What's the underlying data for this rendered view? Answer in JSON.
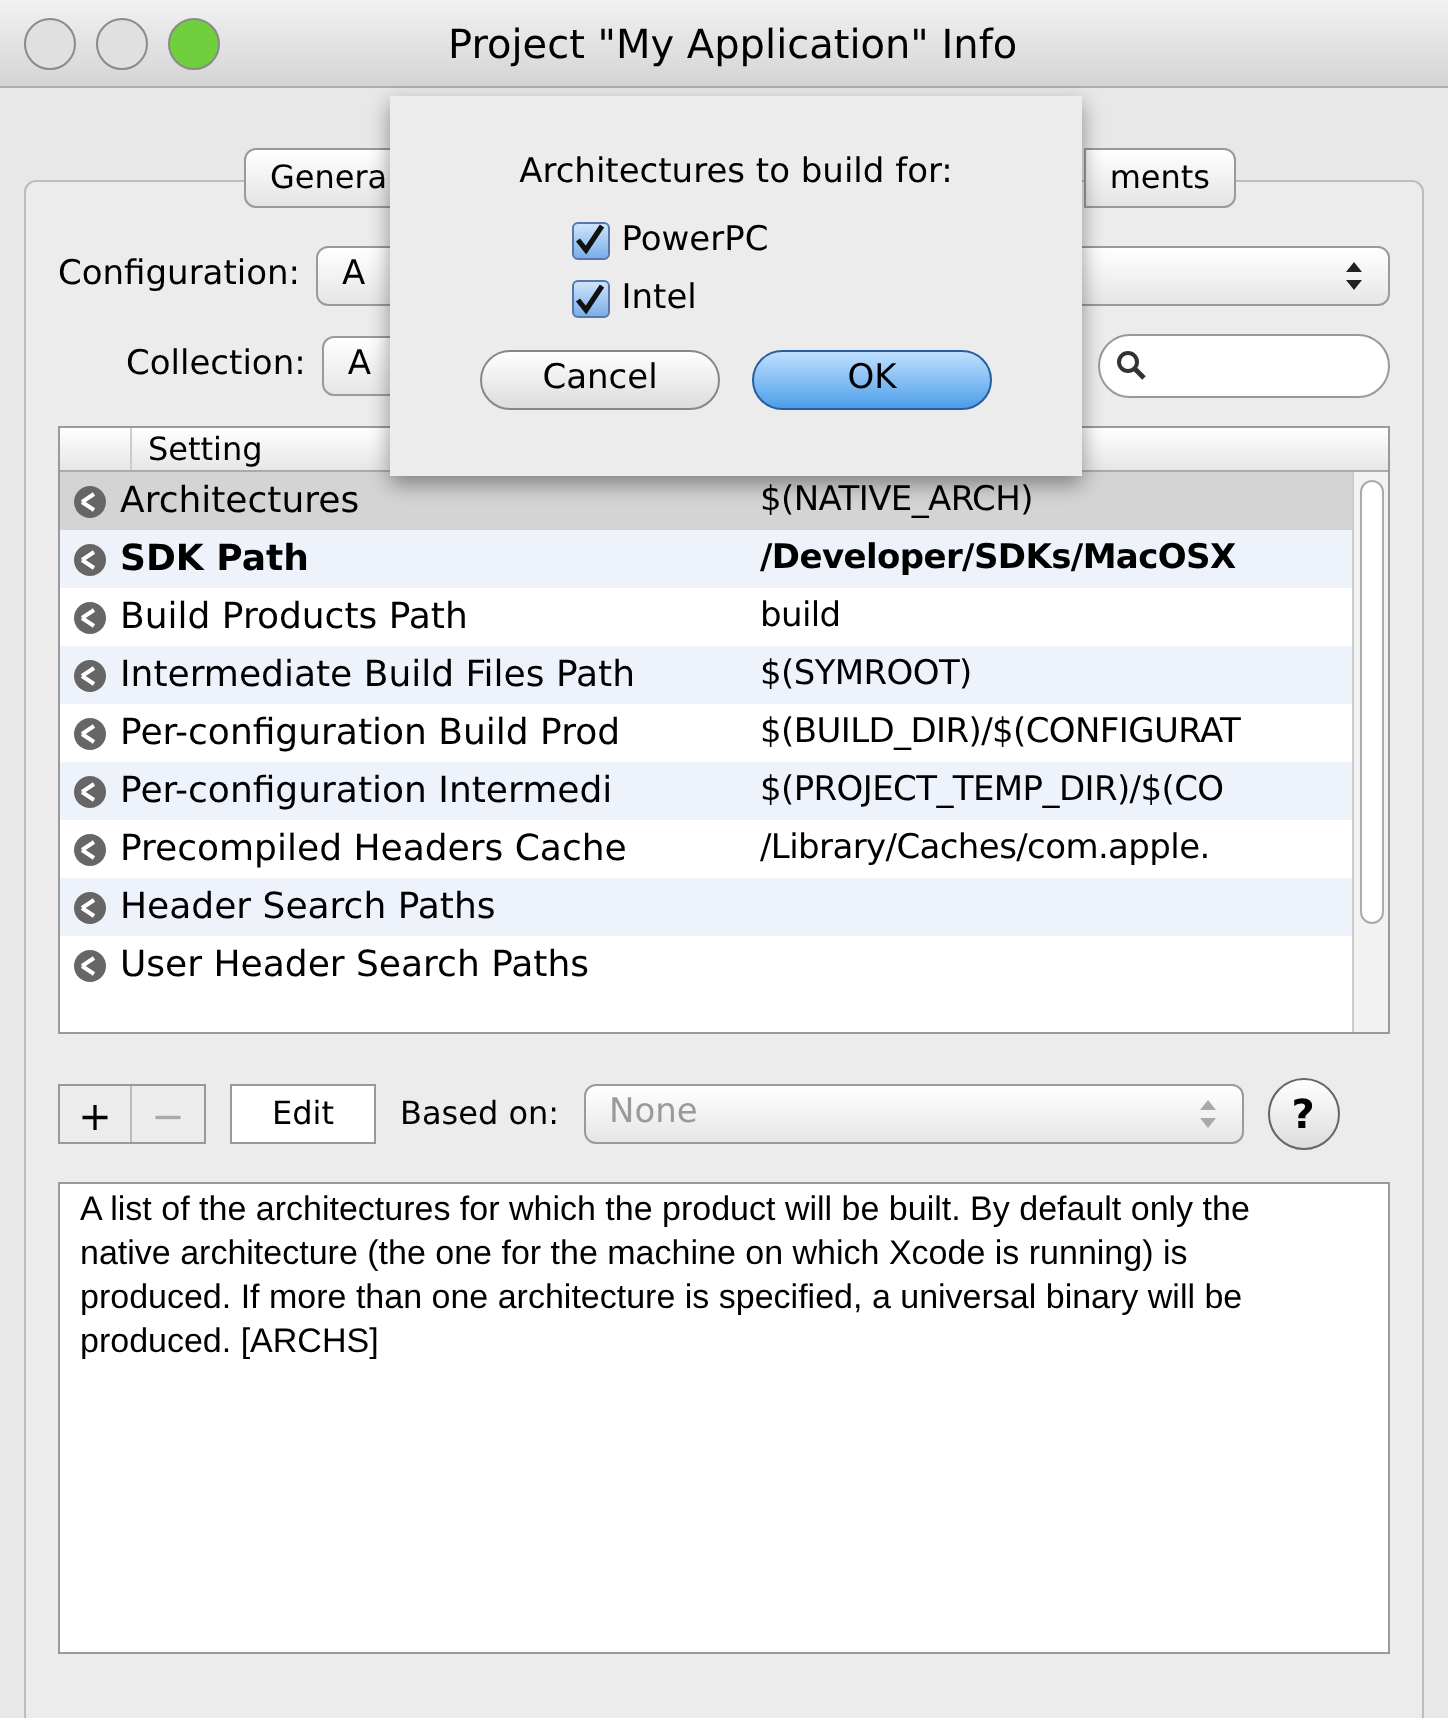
{
  "window": {
    "title": "Project \"My Application\" Info"
  },
  "tabs": [
    {
      "label": "Genera"
    },
    {
      "label": "ments"
    }
  ],
  "configuration": {
    "label": "Configuration:",
    "value": "A"
  },
  "collection": {
    "label": "Collection:",
    "value": "A"
  },
  "table": {
    "columns": [
      "Setting"
    ],
    "rows": [
      {
        "setting": "Architectures",
        "value": "$(NATIVE_ARCH)",
        "selected": true,
        "emphasized": false
      },
      {
        "setting": "SDK Path",
        "value": "/Developer/SDKs/MacOSX",
        "selected": false,
        "emphasized": true
      },
      {
        "setting": "Build Products Path",
        "value": "build",
        "selected": false,
        "emphasized": false
      },
      {
        "setting": "Intermediate Build Files Path",
        "value": "$(SYMROOT)",
        "selected": false,
        "emphasized": false
      },
      {
        "setting": "Per-configuration Build Prod",
        "value": "$(BUILD_DIR)/$(CONFIGURAT",
        "selected": false,
        "emphasized": false
      },
      {
        "setting": "Per-configuration Intermedi",
        "value": "$(PROJECT_TEMP_DIR)/$(CO",
        "selected": false,
        "emphasized": false
      },
      {
        "setting": "Precompiled Headers Cache",
        "value": "/Library/Caches/com.apple.",
        "selected": false,
        "emphasized": false
      },
      {
        "setting": "Header Search Paths",
        "selected": false,
        "emphasized": false
      },
      {
        "setting": "User Header Search Paths",
        "selected": false,
        "emphasized": false
      }
    ]
  },
  "toolbar": {
    "add": {
      "label": "+",
      "disabled": false
    },
    "remove": {
      "label": "−",
      "disabled": true
    },
    "edit": "Edit",
    "based_on": {
      "label": "Based on:",
      "value": "None",
      "disabled": true
    },
    "help": "?"
  },
  "description": "A list of the architectures for which the product will be built.  By default only the native architecture (the one for the machine on which Xcode is running) is produced.  If more than one architecture is specified, a universal binary will be produced. [ARCHS]",
  "sheet": {
    "title": "Architectures to build for:",
    "options": [
      {
        "label": "PowerPC",
        "checked": true
      },
      {
        "label": "Intel",
        "checked": true
      }
    ],
    "buttons": [
      {
        "label": "Cancel",
        "kind": "plain"
      },
      {
        "label": "OK",
        "kind": "default"
      }
    ]
  }
}
